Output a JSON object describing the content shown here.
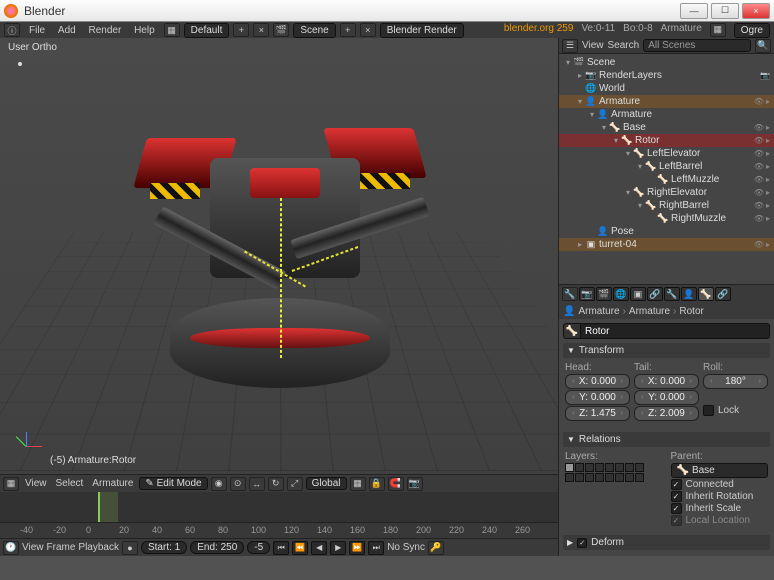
{
  "titlebar": {
    "title": "Blender"
  },
  "winbtns": {
    "min": "—",
    "max": "☐",
    "close": "×"
  },
  "menubar": {
    "items": [
      "File",
      "Add",
      "Render",
      "Help"
    ]
  },
  "topbar": {
    "layout": "Default",
    "scene": "Scene",
    "engine": "Blender Render",
    "link": "blender.org 259",
    "stats": {
      "ve": "Ve:0-11",
      "bo": "Bo:0-8",
      "obj": "Armature"
    },
    "last_dd": "Ogre"
  },
  "viewport": {
    "info": "User Ortho",
    "selection": "(-5) Armature:Rotor"
  },
  "header3d": {
    "menus": [
      "View",
      "Select",
      "Armature"
    ],
    "mode": "Edit Mode",
    "orientation": "Global"
  },
  "timeline_ticks": [
    "-40",
    "-20",
    "0",
    "20",
    "40",
    "60",
    "80",
    "100",
    "120",
    "140",
    "160",
    "180",
    "200",
    "220",
    "240",
    "260"
  ],
  "timeline": {
    "menus": [
      "View",
      "Frame",
      "Playback"
    ],
    "start_lbl": "Start:",
    "start": "1",
    "end_lbl": "End:",
    "end": "250",
    "cur": "-5",
    "sync": "No Sync"
  },
  "outliner": {
    "menus": [
      "View",
      "Search"
    ],
    "filter": "All Scenes",
    "tree": [
      {
        "d": 0,
        "exp": "▾",
        "ico": "🎬",
        "label": "Scene",
        "t": []
      },
      {
        "d": 1,
        "exp": "▸",
        "ico": "📷",
        "label": "RenderLayers",
        "t": [
          "📷"
        ]
      },
      {
        "d": 1,
        "exp": "",
        "ico": "🌐",
        "label": "World",
        "t": []
      },
      {
        "d": 1,
        "exp": "▾",
        "ico": "👤",
        "label": "Armature",
        "sel": "sel",
        "t": [
          "👁",
          "▸"
        ]
      },
      {
        "d": 2,
        "exp": "▾",
        "ico": "👤",
        "label": "Armature",
        "t": []
      },
      {
        "d": 3,
        "exp": "▾",
        "ico": "🦴",
        "label": "Base",
        "t": [
          "👁",
          "▸"
        ]
      },
      {
        "d": 4,
        "exp": "▾",
        "ico": "🦴",
        "label": "Rotor",
        "sel": "sel2",
        "t": [
          "👁",
          "▸"
        ]
      },
      {
        "d": 5,
        "exp": "▾",
        "ico": "🦴",
        "label": "LeftElevator",
        "t": [
          "👁",
          "▸"
        ]
      },
      {
        "d": 6,
        "exp": "▾",
        "ico": "🦴",
        "label": "LeftBarrel",
        "t": [
          "👁",
          "▸"
        ]
      },
      {
        "d": 7,
        "exp": "",
        "ico": "🦴",
        "label": "LeftMuzzle",
        "t": [
          "👁",
          "▸"
        ]
      },
      {
        "d": 5,
        "exp": "▾",
        "ico": "🦴",
        "label": "RightElevator",
        "t": [
          "👁",
          "▸"
        ]
      },
      {
        "d": 6,
        "exp": "▾",
        "ico": "🦴",
        "label": "RightBarrel",
        "t": [
          "👁",
          "▸"
        ]
      },
      {
        "d": 7,
        "exp": "",
        "ico": "🦴",
        "label": "RightMuzzle",
        "t": [
          "👁",
          "▸"
        ]
      },
      {
        "d": 2,
        "exp": "",
        "ico": "👤",
        "label": "Pose",
        "t": []
      },
      {
        "d": 1,
        "exp": "▸",
        "ico": "▣",
        "label": "turret-04",
        "sel": "sel",
        "t": [
          "👁",
          "▸"
        ]
      }
    ]
  },
  "crumbs": [
    "Armature",
    "Armature",
    "Rotor"
  ],
  "name_field": "Rotor",
  "transform": {
    "title": "Transform",
    "head_lbl": "Head:",
    "tail_lbl": "Tail:",
    "roll_lbl": "Roll:",
    "head": {
      "x": "X: 0.000",
      "y": "Y: 0.000",
      "z": "Z: 1.475"
    },
    "tail": {
      "x": "X: 0.000",
      "y": "Y: 0.000",
      "z": "Z: 2.009"
    },
    "roll": "180°",
    "lock": "Lock"
  },
  "relations": {
    "title": "Relations",
    "layers_lbl": "Layers:",
    "parent_lbl": "Parent:",
    "parent": "Base",
    "connected": "Connected",
    "inh_rot": "Inherit Rotation",
    "inh_scale": "Inherit Scale",
    "local_loc": "Local Location"
  },
  "deform": {
    "title": "Deform"
  }
}
